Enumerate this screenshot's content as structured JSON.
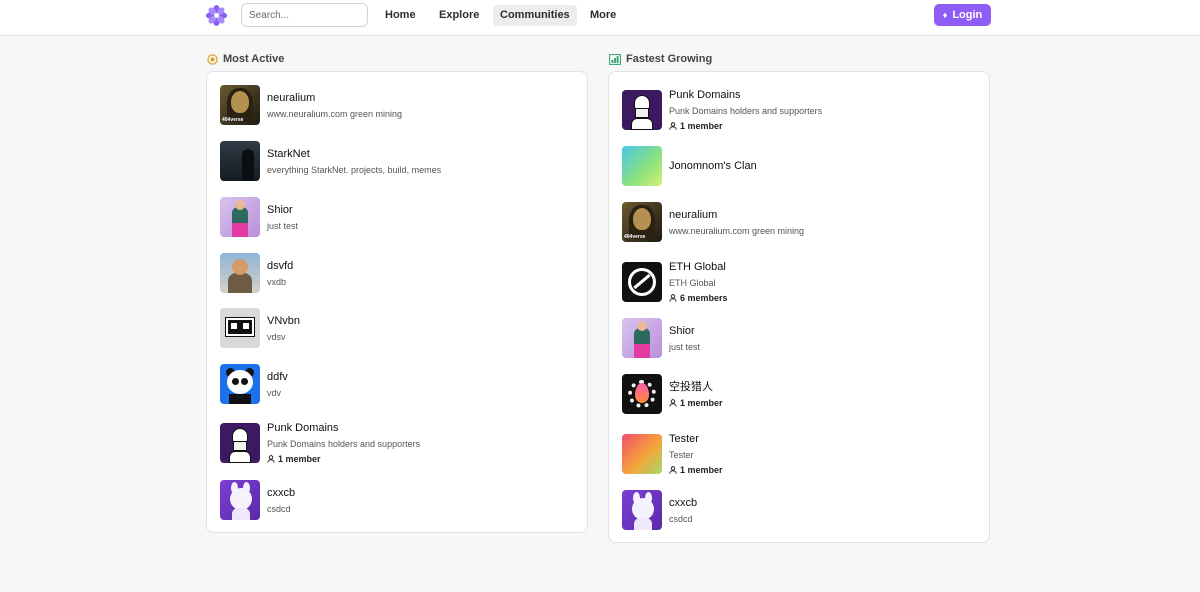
{
  "header": {
    "logo_icon": "flower-logo-icon",
    "search_placeholder": "Search...",
    "nav": [
      {
        "label": "Home"
      },
      {
        "label": "Explore"
      },
      {
        "label": "Communities",
        "active": true
      },
      {
        "label": "More"
      }
    ],
    "login_label": "Login",
    "login_icon": "ethereum-icon",
    "accent_color": "#8f5cf5"
  },
  "most_active": {
    "title": "Most Active",
    "icon": "medal-icon",
    "items": [
      {
        "name": "neuralium",
        "desc": "www.neuralium.com green mining",
        "avatar": "neuralium",
        "avatar_tag": "404verse"
      },
      {
        "name": "StarkNet",
        "desc": "everything StarkNet. projects, build, memes",
        "avatar": "starknet"
      },
      {
        "name": "Shior",
        "desc": "just test",
        "avatar": "shior"
      },
      {
        "name": "dsvfd",
        "desc": "vxdb",
        "avatar": "dsvfd"
      },
      {
        "name": "VNvbn",
        "desc": "vdsv",
        "avatar": "vnvbn"
      },
      {
        "name": "ddfv",
        "desc": "vdv",
        "avatar": "ddfv"
      },
      {
        "name": "Punk Domains",
        "desc": "Punk Domains holders and supporters",
        "members": "1 member",
        "avatar": "punk"
      },
      {
        "name": "cxxcb",
        "desc": "csdcd",
        "avatar": "cxxcb"
      }
    ]
  },
  "fastest_growing": {
    "title": "Fastest Growing",
    "icon": "bar-chart-icon",
    "items": [
      {
        "name": "Punk Domains",
        "desc": "Punk Domains holders and supporters",
        "members": "1 member",
        "avatar": "punk"
      },
      {
        "name": "Jonomnom's Clan",
        "avatar": "jono"
      },
      {
        "name": "neuralium",
        "desc": "www.neuralium.com green mining",
        "avatar": "neuralium",
        "avatar_tag": "404verse"
      },
      {
        "name": "ETH Global",
        "desc": "ETH Global",
        "members": "6 members",
        "avatar": "eth"
      },
      {
        "name": "Shior",
        "desc": "just test",
        "avatar": "shior"
      },
      {
        "name": "空投猎人",
        "members": "1 member",
        "avatar": "kongtou"
      },
      {
        "name": "Tester",
        "desc": "Tester",
        "members": "1 member",
        "avatar": "tester"
      },
      {
        "name": "cxxcb",
        "desc": "csdcd",
        "avatar": "cxxcb"
      }
    ]
  }
}
